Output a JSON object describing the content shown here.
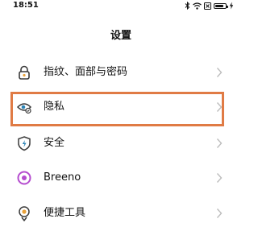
{
  "status_bar": {
    "time": "18:51"
  },
  "header": {
    "title": "设置"
  },
  "settings": {
    "items": [
      {
        "label": "指纹、面部与密码",
        "icon": "lock-icon",
        "icon_color": "#e9a23b"
      },
      {
        "label": "隐私",
        "icon": "privacy-eye-icon",
        "icon_color": "#2a83b6"
      },
      {
        "label": "安全",
        "icon": "security-shield-icon",
        "icon_color": "#2a83b6"
      },
      {
        "label": "Breeno",
        "icon": "breeno-icon",
        "icon_color": "#b54dcf"
      },
      {
        "label": "便捷工具",
        "icon": "tools-icon",
        "icon_color": "#e9a23b"
      }
    ]
  },
  "highlight": {
    "target": "隐私",
    "color": "#e07b45"
  },
  "battery": {
    "level": 0.8
  }
}
